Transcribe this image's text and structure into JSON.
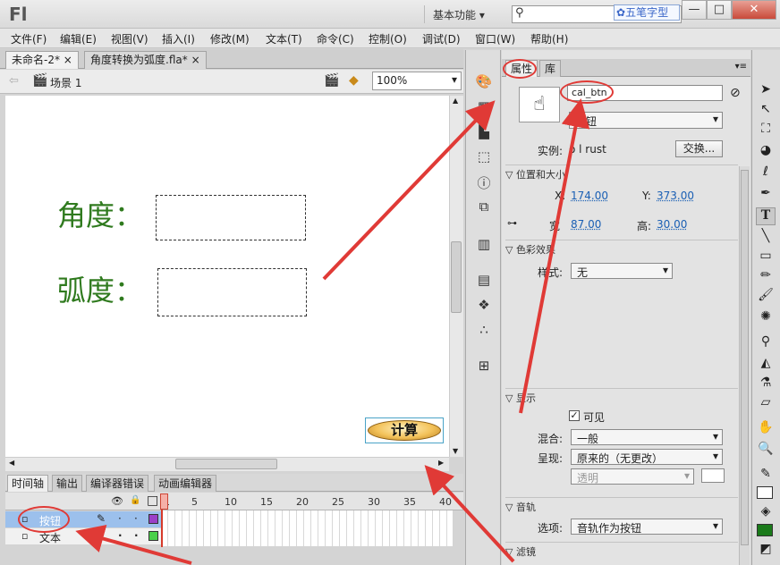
{
  "app": {
    "logo": "Fl",
    "workspace": "基本功能",
    "search_placeholder": "",
    "watermark": "五笔字型"
  },
  "window_buttons": {
    "minimize": "—",
    "maximize": "□",
    "close": "✕"
  },
  "menu": [
    "文件(F)",
    "编辑(E)",
    "视图(V)",
    "插入(I)",
    "修改(M)",
    "文本(T)",
    "命令(C)",
    "控制(O)",
    "调试(D)",
    "窗口(W)",
    "帮助(H)"
  ],
  "doc_tabs": [
    {
      "label": "未命名-2*",
      "close": "×"
    },
    {
      "label": "角度转换为弧度.fla*",
      "close": "×"
    }
  ],
  "scene": {
    "label": "场景 1",
    "zoom": "100%"
  },
  "stage": {
    "label_angle": "角度：",
    "label_radian": "弧度：",
    "calc_button": "计算"
  },
  "timeline": {
    "tabs": [
      "时间轴",
      "输出",
      "编译器错误",
      "动画编辑器"
    ],
    "frame_numbers": [
      "1",
      "5",
      "10",
      "15",
      "20",
      "25",
      "30",
      "35",
      "40"
    ],
    "layers": [
      {
        "name": "按钮"
      },
      {
        "name": "文本"
      }
    ],
    "header_icons": {
      "eye": "👁",
      "lock": "🔒",
      "outline": "□"
    }
  },
  "properties": {
    "tabs": [
      "属性",
      "库"
    ],
    "instance_name": "cal_btn",
    "type": "按钮",
    "instance_label": "实例:",
    "instance_of": "o  l rust",
    "swap_button": "交换...",
    "section_position": "位置和大小",
    "x_label": "X:",
    "x_value": "174.00",
    "y_label": "Y:",
    "y_value": "373.00",
    "w_label": "宽",
    "w_value": "87.00",
    "h_label": "高:",
    "h_value": "30.00",
    "section_color": "色彩效果",
    "style_label": "样式:",
    "style_value": "无",
    "section_display": "显示",
    "visible_label": "可见",
    "blend_label": "混合:",
    "blend_value": "一般",
    "render_label": "呈现:",
    "render_value": "原来的（无更改）",
    "transparent_value": "透明",
    "section_track": "音轨",
    "options_label": "选项:",
    "options_value": "音轨作为按钮",
    "section_filter": "滤镜"
  },
  "icons": {
    "search": "search-icon",
    "scene_clapper": "clapper-icon",
    "symbol": "button-symbol-icon"
  },
  "colors": {
    "stage_text": "#2f7a1e",
    "annotation": "#e03a36",
    "link_value": "#1a5fb4"
  }
}
